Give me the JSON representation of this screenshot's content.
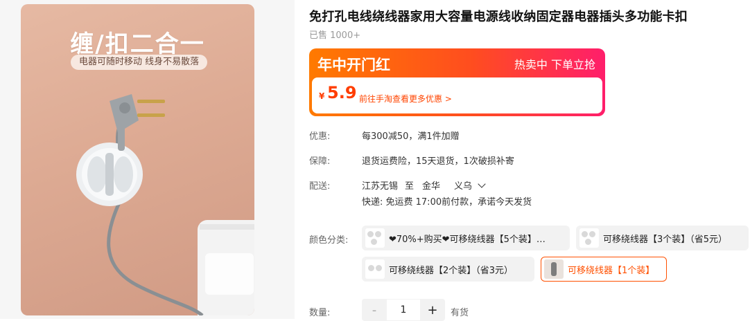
{
  "image": {
    "headline": "缠/扣二合一",
    "tagline": "电器可随时移动 线身不易散落"
  },
  "product": {
    "title": "免打孔电线绕线器家用大容量电源线收纳固定器电器插头多功能卡扣",
    "sold": "已售 1000+"
  },
  "promo": {
    "title": "年中开门红",
    "status": "热卖中 下单立抢",
    "currency": "¥",
    "price": "5.9",
    "link": "前往手淘查看更多优惠 >"
  },
  "rows": {
    "discount": {
      "label": "优惠:",
      "value": "每300减50，满1件加赠"
    },
    "guarantee": {
      "label": "保障:",
      "value": "退货运费险，15天退货，1次破损补寄"
    },
    "shipping": {
      "label": "配送:",
      "from": "江苏无锡",
      "sep": "至",
      "to_city": "金华",
      "to_district": "义乌",
      "express": "快递: 免运费  17:00前付款，承诺今天发货"
    }
  },
  "sku": {
    "label": "颜色分类:",
    "options": [
      {
        "text": "❤70%+购买❤可移绕线器【5个装】…",
        "selected": false
      },
      {
        "text": "可移绕线器【3个装】（省5元）",
        "selected": false
      },
      {
        "text": "可移绕线器【2个装】（省3元）",
        "selected": false
      },
      {
        "text": "可移绕线器【1个装】",
        "selected": true
      }
    ]
  },
  "quantity": {
    "label": "数量:",
    "minus": "-",
    "value": "1",
    "plus": "+",
    "stock": "有货"
  },
  "colors": {
    "accent": "#ff5000",
    "price": "#ff3d00",
    "promo_gradient": [
      "#ff7a00",
      "#ff4d1f",
      "#ff1e6b"
    ]
  },
  "icons": {
    "chevron": "chevron-down-icon",
    "sku_thumb": "product-thumbnail"
  }
}
